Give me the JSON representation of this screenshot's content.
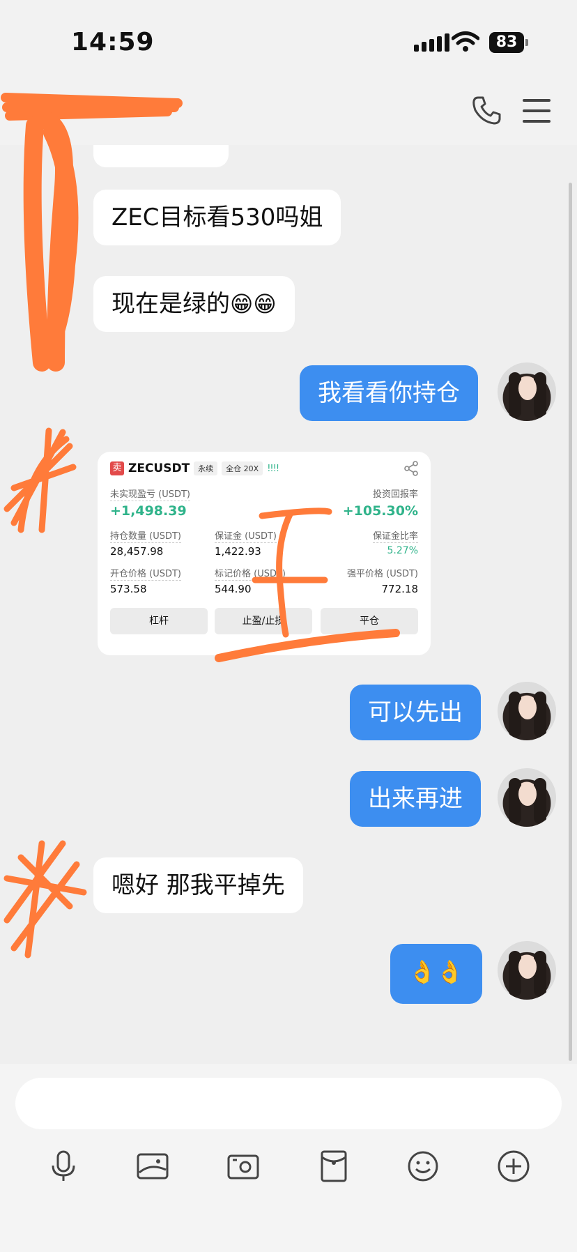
{
  "status_bar": {
    "time": "14:59",
    "battery": "83"
  },
  "messages": [
    {
      "side": "in",
      "text": "ZEC目标看530吗姐"
    },
    {
      "side": "in",
      "text": "现在是绿的",
      "emoji": "😁😁"
    },
    {
      "side": "out",
      "text": "我看看你持仓"
    },
    {
      "side": "out",
      "text": "可以先出"
    },
    {
      "side": "out",
      "text": "出来再进"
    },
    {
      "side": "in",
      "text": "嗯好 那我平掉先"
    },
    {
      "side": "out",
      "text": "",
      "emoji": "👌👌"
    }
  ],
  "trade_card": {
    "sell_tag": "卖",
    "symbol": "ZECUSDT",
    "contract_type": "永续",
    "margin_mode": "全仓 20X",
    "signal_bars": "!!!!",
    "unrealized_pnl_label": "未实现盈亏 (USDT)",
    "unrealized_pnl_value": "+1,498.39",
    "roi_label": "投资回报率",
    "roi_value": "+105.30%",
    "position_size_label": "持仓数量 (USDT)",
    "position_size_value": "28,457.98",
    "margin_label": "保证金 (USDT)",
    "margin_value": "1,422.93",
    "margin_ratio_label": "保证金比率",
    "margin_ratio_value": "5.27%",
    "entry_price_label": "开仓价格 (USDT)",
    "entry_price_value": "573.58",
    "mark_price_label": "标记价格 (USDT)",
    "mark_price_value": "544.90",
    "liq_price_label": "强平价格 (USDT)",
    "liq_price_value": "772.18",
    "buttons": {
      "leverage": "杠杆",
      "tp_sl": "止盈/止损",
      "close": "平仓"
    }
  },
  "colors": {
    "outgoing_bubble": "#3d8ef0",
    "profit_green": "#2fb38a",
    "scribble": "#ff7b3a"
  }
}
